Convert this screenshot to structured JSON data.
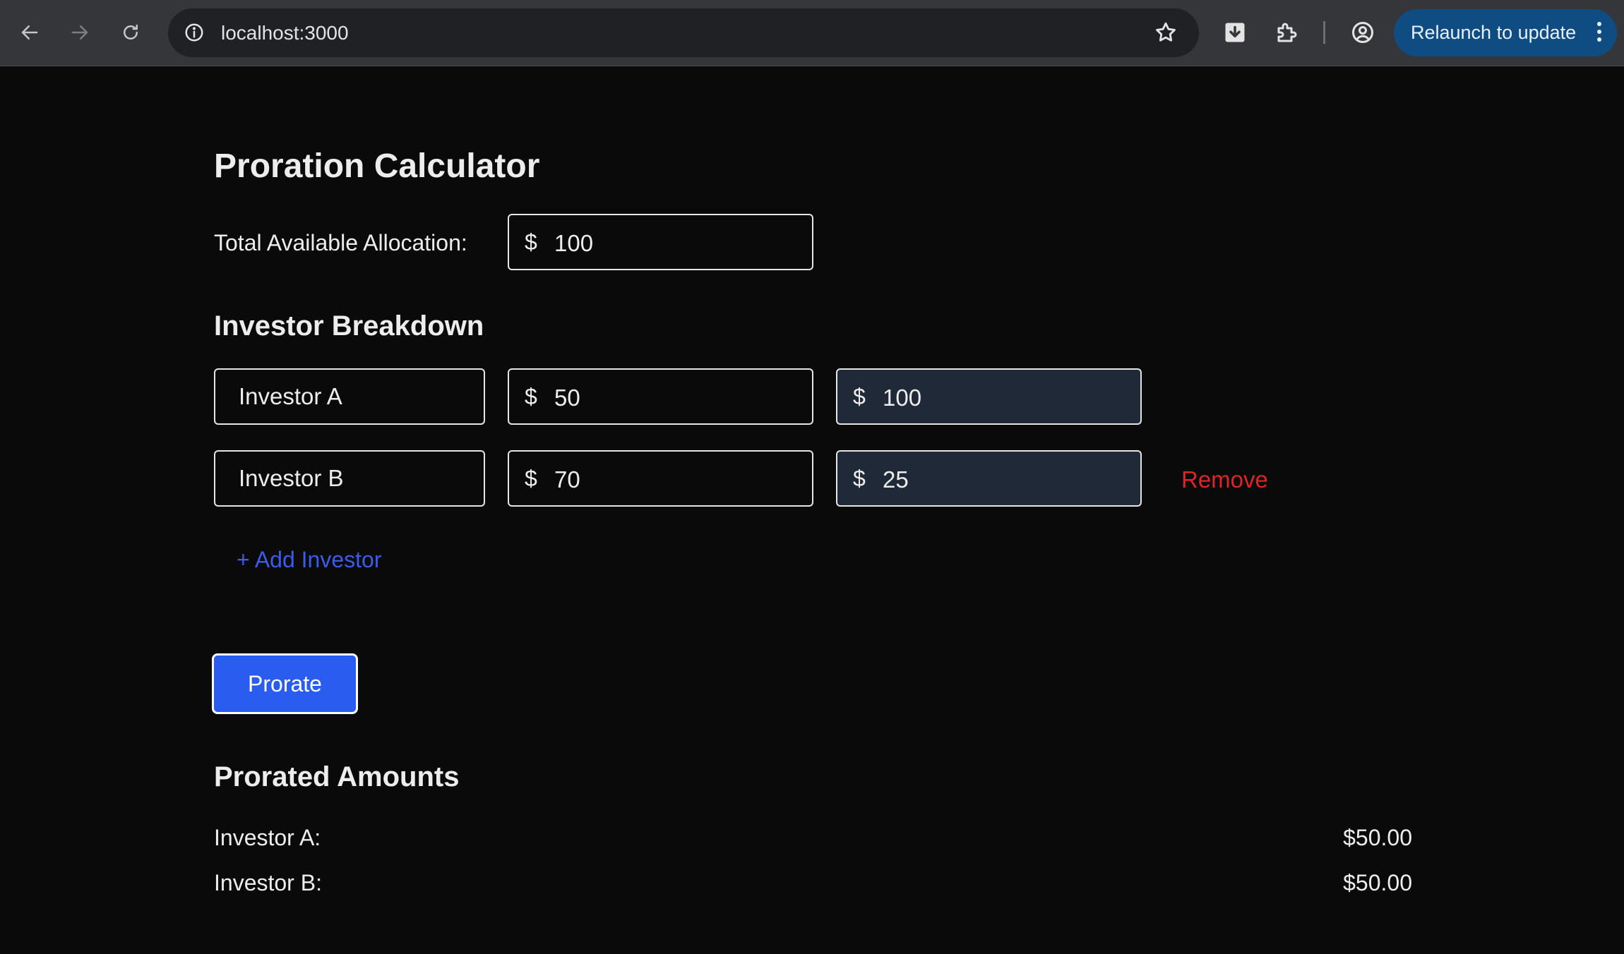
{
  "browser": {
    "url": "localhost:3000",
    "relaunch_label": "Relaunch to update",
    "icons": [
      "back-arrow-icon",
      "forward-arrow-icon",
      "reload-icon",
      "info-icon",
      "star-icon",
      "download-icon",
      "extensions-icon",
      "profile-icon",
      "kebab-menu-icon"
    ]
  },
  "page": {
    "title": "Proration Calculator",
    "total_label": "Total Available Allocation:",
    "currency_symbol": "$",
    "total_value": "100",
    "breakdown_title": "Investor Breakdown",
    "investors": [
      {
        "name": "Investor A",
        "requested": "50",
        "historical": "100"
      },
      {
        "name": "Investor B",
        "requested": "70",
        "historical": "25"
      }
    ],
    "remove_label": "Remove",
    "add_investor_label": "+ Add Investor",
    "prorate_label": "Prorate",
    "results_title": "Prorated Amounts",
    "results": [
      {
        "label": "Investor A:",
        "amount": "$50.00"
      },
      {
        "label": "Investor B:",
        "amount": "$50.00"
      }
    ]
  },
  "colors": {
    "background": "#0a0a0b",
    "readonly_field": "#1f2937",
    "primary_button": "#2b5cf0",
    "link": "#3b5ce8",
    "danger": "#dc2626",
    "relaunch_button": "#0f4c81"
  }
}
